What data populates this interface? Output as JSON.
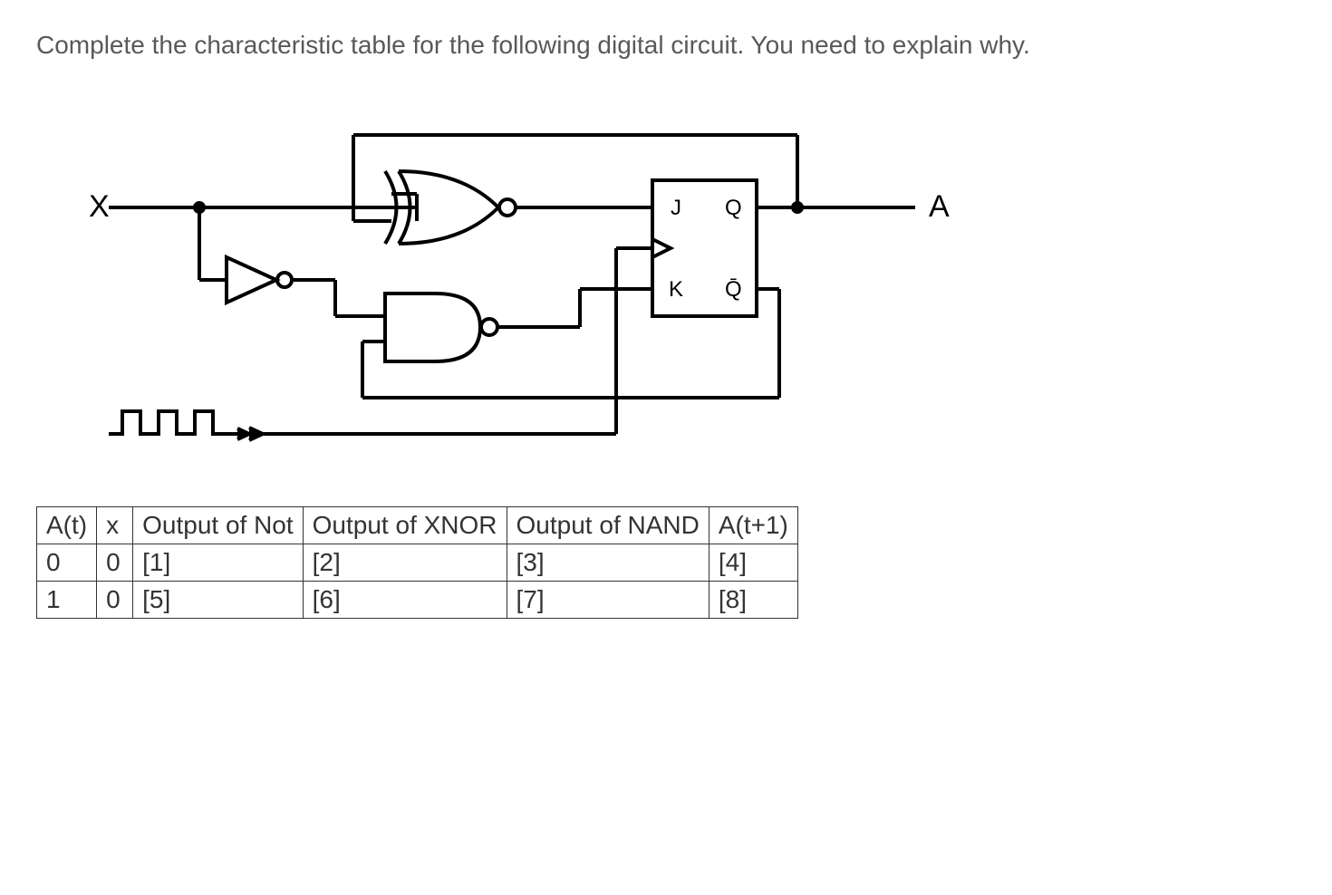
{
  "prompt": "Complete the characteristic table for the following digital circuit. You need to explain why.",
  "circuit": {
    "input_label": "X",
    "output_label": "A",
    "ff_j": "J",
    "ff_k": "K",
    "ff_q": "Q",
    "ff_qbar": "Q̄"
  },
  "table": {
    "headers": [
      "A(t)",
      "x",
      "Output of Not",
      "Output of XNOR",
      "Output of NAND",
      "A(t+1)"
    ],
    "rows": [
      [
        "0",
        "0",
        "[1]",
        "[2]",
        "[3]",
        "[4]"
      ],
      [
        "1",
        "0",
        "[5]",
        "[6]",
        "[7]",
        "[8]"
      ]
    ]
  }
}
